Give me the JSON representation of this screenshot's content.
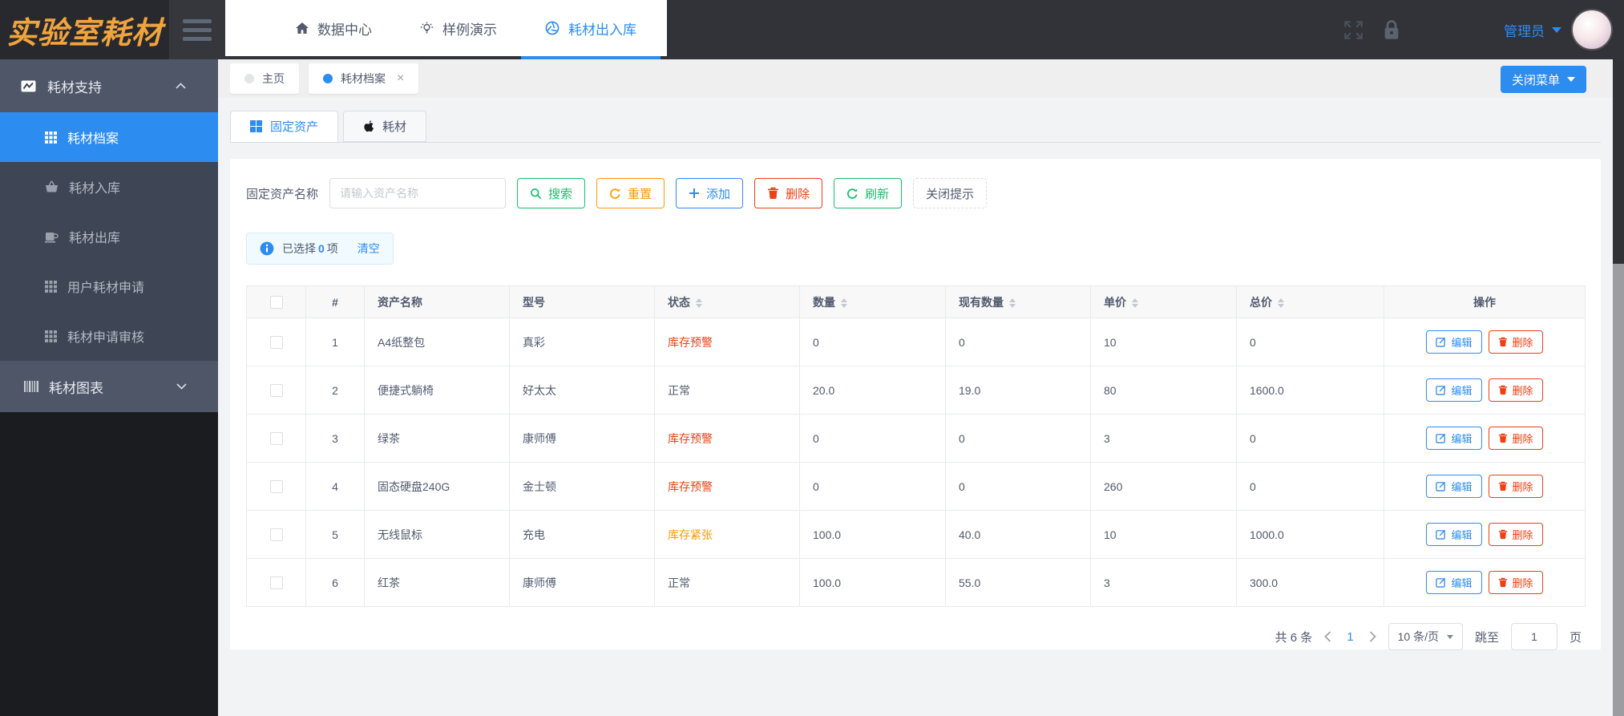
{
  "header": {
    "logo_text": "实验室耗材",
    "nav": [
      {
        "label": "数据中心"
      },
      {
        "label": "样例演示"
      },
      {
        "label": "耗材出入库"
      }
    ],
    "username": "管理员"
  },
  "sidebar": {
    "group1": {
      "label": "耗材支持"
    },
    "items": [
      {
        "label": "耗材档案"
      },
      {
        "label": "耗材入库"
      },
      {
        "label": "耗材出库"
      },
      {
        "label": "用户耗材申请"
      },
      {
        "label": "耗材申请审核"
      }
    ],
    "group2": {
      "label": "耗材图表"
    }
  },
  "crumbs": {
    "home_tab": "主页",
    "active_tab": "耗材档案",
    "close_menu": "关闭菜单"
  },
  "page_tabs": {
    "fixed_assets": "固定资产",
    "consumables": "耗材"
  },
  "search": {
    "label": "固定资产名称",
    "placeholder": "请输入资产名称",
    "search": "搜索",
    "reset": "重置",
    "add": "添加",
    "delete": "删除",
    "refresh": "刷新",
    "close_tip": "关闭提示"
  },
  "selection": {
    "prefix": "已选择",
    "count": "0",
    "suffix": "项",
    "clear": "清空"
  },
  "table": {
    "columns": {
      "index": "#",
      "name": "资产名称",
      "model": "型号",
      "status": "状态",
      "qty": "数量",
      "current": "现有数量",
      "unit_price": "单价",
      "total_price": "总价",
      "ops": "操作"
    },
    "ops": {
      "edit": "编辑",
      "del": "删除"
    },
    "rows": [
      {
        "index": "1",
        "name": "A4纸整包",
        "model": "真彩",
        "status": "库存预警",
        "status_class": "danger",
        "qty": "0",
        "current": "0",
        "unit": "10",
        "total": "0"
      },
      {
        "index": "2",
        "name": "便捷式躺椅",
        "model": "好太太",
        "status": "正常",
        "status_class": "normal",
        "qty": "20.0",
        "current": "19.0",
        "unit": "80",
        "total": "1600.0"
      },
      {
        "index": "3",
        "name": "绿茶",
        "model": "康师傅",
        "status": "库存预警",
        "status_class": "danger",
        "qty": "0",
        "current": "0",
        "unit": "3",
        "total": "0"
      },
      {
        "index": "4",
        "name": "固态硬盘240G",
        "model": "金士顿",
        "status": "库存预警",
        "status_class": "danger",
        "qty": "0",
        "current": "0",
        "unit": "260",
        "total": "0"
      },
      {
        "index": "5",
        "name": "无线鼠标",
        "model": "充电",
        "status": "库存紧张",
        "status_class": "warning",
        "qty": "100.0",
        "current": "40.0",
        "unit": "10",
        "total": "1000.0"
      },
      {
        "index": "6",
        "name": "红茶",
        "model": "康师傅",
        "status": "正常",
        "status_class": "normal",
        "qty": "100.0",
        "current": "55.0",
        "unit": "3",
        "total": "300.0"
      }
    ]
  },
  "pagination": {
    "total": "共 6 条",
    "page": "1",
    "size": "10 条/页",
    "jump": "跳至",
    "jump_value": "1",
    "unit": "页"
  },
  "colors": {
    "accent": "#2d8cf0",
    "success": "#19be6b",
    "warning": "#ff9900",
    "danger": "#ed4014",
    "logo": "#f0a43e"
  }
}
